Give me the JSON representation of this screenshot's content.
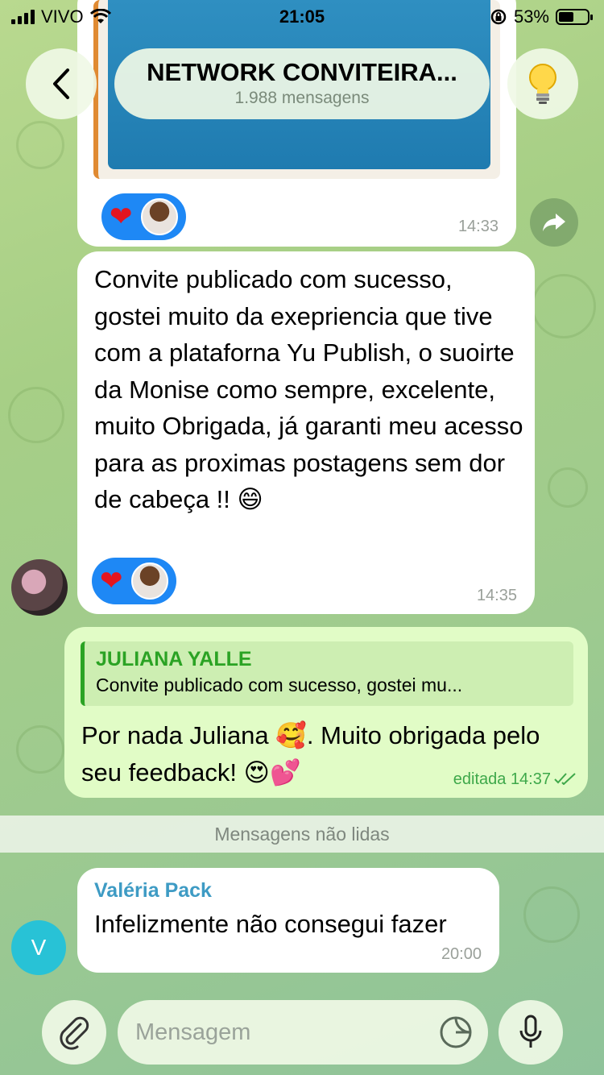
{
  "status_bar": {
    "carrier": "VIVO",
    "time": "21:05",
    "battery_percent": "53%",
    "battery_level": 0.53
  },
  "header": {
    "title": "NETWORK CONVITEIRA...",
    "subtitle": "1.988 mensagens",
    "back_icon": "chevron-left-icon",
    "right_icon": "lightbulb-icon"
  },
  "messages": [
    {
      "id": "media-message",
      "time": "14:33",
      "reaction": "heart"
    },
    {
      "id": "juliana-message",
      "text": "Convite publicado com sucesso, gostei muito da exepriencia que tive com a plataforna Yu Publish, o suoirte da Monise como sempre, excelente, muito Obrigada, já garanti meu acesso para as proximas postagens sem dor de cabeça !!",
      "text_emoji": "😄",
      "time": "14:35",
      "reaction": "heart"
    },
    {
      "id": "reply-message",
      "reply_name": "JULIANA YALLE",
      "reply_text": "Convite publicado com sucesso, gostei mu...",
      "text_part1": "Por nada Juliana ",
      "emoji1": "🥰",
      "text_part2": ". Muito obrigada pelo seu feedback! ",
      "emoji2": "😍",
      "emoji3": "💕",
      "time": "editada 14:37"
    },
    {
      "id": "valeria-message",
      "sender": "Valéria Pack",
      "text": "Infelizmente não consegui fazer",
      "time": "20:00",
      "avatar_letter": "V"
    }
  ],
  "unread_divider": "Mensagens não lidas",
  "composer": {
    "placeholder": "Mensagem",
    "attach_icon": "paperclip-icon",
    "sticker_icon": "sticker-icon",
    "mic_icon": "microphone-icon"
  },
  "colors": {
    "outgoing_bubble": "#e1fcc6",
    "incoming_bubble": "#ffffff",
    "reaction_pill": "#1e88f5",
    "reply_accent": "#2ba324",
    "sender_valeria": "#3e9bc4"
  }
}
